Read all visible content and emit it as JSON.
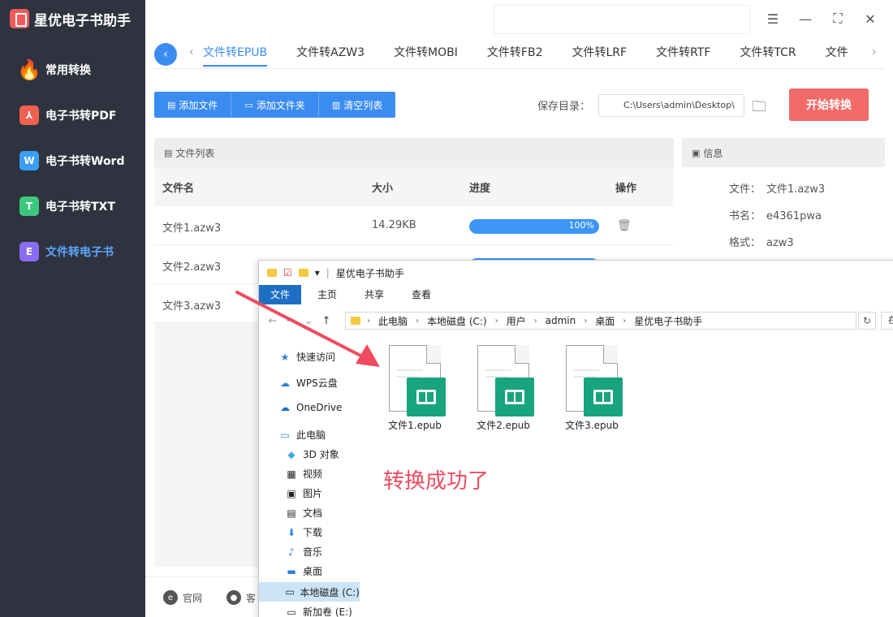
{
  "app": {
    "title": "星优电子书助手"
  },
  "sidebar": {
    "items": [
      {
        "label": "常用转换",
        "icon": "fire-icon",
        "active": false
      },
      {
        "label": "电子书转PDF",
        "icon": "pdf-icon",
        "glyph": "⅄",
        "active": false
      },
      {
        "label": "电子书转Word",
        "icon": "word-icon",
        "glyph": "W",
        "active": false
      },
      {
        "label": "电子书转TXT",
        "icon": "txt-icon",
        "glyph": "T",
        "active": false
      },
      {
        "label": "文件转电子书",
        "icon": "ebook-icon",
        "glyph": "E",
        "active": true
      }
    ]
  },
  "tabs": [
    "文件转EPUB",
    "文件转AZW3",
    "文件转MOBI",
    "文件转FB2",
    "文件转LRF",
    "文件转RTF",
    "文件转TCR",
    "文件"
  ],
  "toolbar": {
    "add_file": "添加文件",
    "add_folder": "添加文件夹",
    "clear_list": "清空列表",
    "save_label": "保存目录：",
    "save_path": "C:\\Users\\admin\\Desktop\\",
    "start": "开始转换"
  },
  "file_list": {
    "title": "文件列表",
    "headers": {
      "name": "文件名",
      "size": "大小",
      "progress": "进度",
      "action": "操作"
    },
    "rows": [
      {
        "name": "文件1.azw3",
        "size": "14.29KB",
        "progress_pct": 100,
        "progress_text": "100%"
      },
      {
        "name": "文件2.azw3",
        "size": "",
        "progress_pct": 100,
        "progress_text": ""
      },
      {
        "name": "文件3.azw3",
        "size": "",
        "progress_pct": 100,
        "progress_text": ""
      }
    ]
  },
  "info": {
    "title": "信息",
    "file_label": "文件：",
    "file_value": "文件1.azw3",
    "book_label": "书名：",
    "book_value": "e4361pwa",
    "format_label": "格式：",
    "format_value": "azw3"
  },
  "bottom": {
    "website": "官网",
    "service": "客"
  },
  "explorer": {
    "title": "星优电子书助手",
    "menu": [
      "文件",
      "主页",
      "共享",
      "查看"
    ],
    "breadcrumb": [
      "此电脑",
      "本地磁盘 (C:)",
      "用户",
      "admin",
      "桌面",
      "星优电子书助手"
    ],
    "search_placeholder": "在",
    "sidebar": [
      {
        "label": "快速访问",
        "icon": "star-icon"
      },
      {
        "label": "WPS云盘",
        "icon": "cloud-icon"
      },
      {
        "label": "OneDrive",
        "icon": "onedrive-icon"
      },
      {
        "label": "此电脑",
        "icon": "computer-icon"
      },
      {
        "label": "3D 对象",
        "icon": "cube-icon"
      },
      {
        "label": "视频",
        "icon": "video-icon"
      },
      {
        "label": "图片",
        "icon": "picture-icon"
      },
      {
        "label": "文档",
        "icon": "document-icon"
      },
      {
        "label": "下载",
        "icon": "download-icon"
      },
      {
        "label": "音乐",
        "icon": "music-icon"
      },
      {
        "label": "桌面",
        "icon": "desktop-icon"
      },
      {
        "label": "本地磁盘 (C:)",
        "icon": "drive-icon"
      },
      {
        "label": "新加卷 (E:)",
        "icon": "drive-icon"
      }
    ],
    "files": [
      "文件1.epub",
      "文件2.epub",
      "文件3.epub"
    ]
  },
  "annotation": {
    "text": "转换成功了",
    "color": "#ef4b5f"
  },
  "colors": {
    "sidebar_bg": "#2e333f",
    "accent": "#3b8cf0",
    "start_button": "#f26a6a",
    "epub_badge": "#17a47e"
  }
}
